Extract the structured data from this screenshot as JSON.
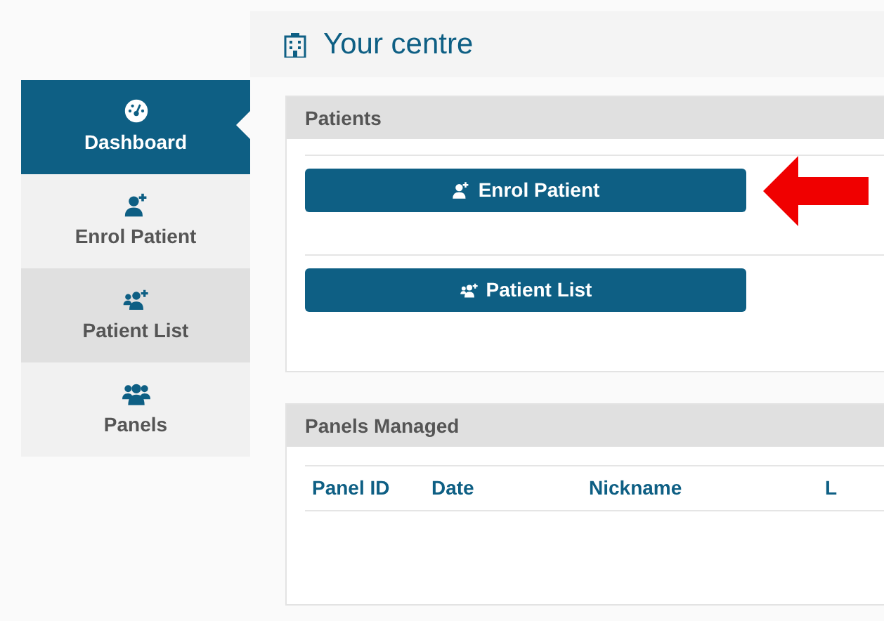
{
  "header": {
    "title": "Your centre"
  },
  "sidebar": {
    "items": [
      {
        "label": "Dashboard",
        "kind": "dashboard",
        "selected": true,
        "highlighted": false
      },
      {
        "label": "Enrol Patient",
        "kind": "enrol",
        "selected": false,
        "highlighted": false
      },
      {
        "label": "Patient List",
        "kind": "list",
        "selected": false,
        "highlighted": true
      },
      {
        "label": "Panels",
        "kind": "panels",
        "selected": false,
        "highlighted": false
      }
    ]
  },
  "patients_panel": {
    "title": "Patients",
    "buttons": [
      {
        "label": "Enrol Patient",
        "kind": "enrol",
        "pointed_at": true
      },
      {
        "label": "Patient List",
        "kind": "list",
        "pointed_at": false
      }
    ]
  },
  "panels_managed": {
    "title": "Panels Managed",
    "table": {
      "columns": [
        "Panel ID",
        "Date",
        "Nickname",
        "L"
      ]
    }
  }
}
